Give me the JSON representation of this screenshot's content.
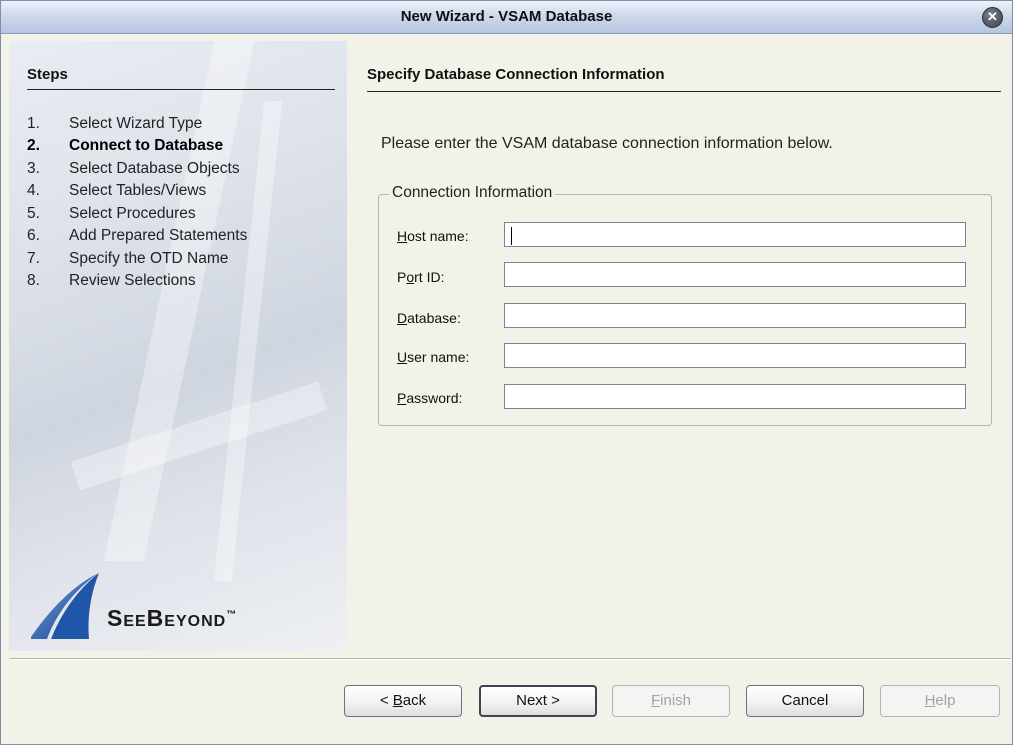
{
  "window": {
    "title": "New Wizard - VSAM Database",
    "close_symbol": "✕"
  },
  "steps": {
    "title": "Steps",
    "items": [
      {
        "num": "1.",
        "label": "Select Wizard Type",
        "current": false
      },
      {
        "num": "2.",
        "label": "Connect to Database",
        "current": true
      },
      {
        "num": "3.",
        "label": "Select Database Objects",
        "current": false
      },
      {
        "num": "4.",
        "label": "Select Tables/Views",
        "current": false
      },
      {
        "num": "5.",
        "label": "Select Procedures",
        "current": false
      },
      {
        "num": "6.",
        "label": "Add Prepared Statements",
        "current": false
      },
      {
        "num": "7.",
        "label": "Specify the OTD Name",
        "current": false
      },
      {
        "num": "8.",
        "label": "Review Selections",
        "current": false
      }
    ]
  },
  "logo": {
    "text": "SeeBeyond",
    "trademark": "™"
  },
  "main": {
    "title": "Specify Database Connection Information",
    "intro": "Please enter the VSAM database connection information below.",
    "group_title": "Connection Information",
    "fields": {
      "host": {
        "label_mnemonic": "H",
        "label_rest": "ost name:",
        "value": ""
      },
      "port": {
        "label_pre": "P",
        "label_mnemonic": "o",
        "label_rest": "rt ID:",
        "value": ""
      },
      "database": {
        "label_mnemonic": "D",
        "label_rest": "atabase:",
        "value": ""
      },
      "user": {
        "label_mnemonic": "U",
        "label_rest": "ser name:",
        "value": ""
      },
      "password": {
        "label_mnemonic": "P",
        "label_rest": "assword:",
        "value": ""
      }
    }
  },
  "buttons": {
    "back": {
      "pre": "< ",
      "mnemonic": "B",
      "rest": "ack"
    },
    "next": {
      "label": "Next >"
    },
    "finish": {
      "mnemonic": "F",
      "rest": "inish"
    },
    "cancel": {
      "label": "Cancel"
    },
    "help": {
      "mnemonic": "H",
      "rest": "elp"
    }
  },
  "colors": {
    "window_bg": "#f3f2e9",
    "title_gradient_bottom": "#b7c5e0",
    "logo_blue": "#1f56a8",
    "disabled_text": "#a3a3a3"
  }
}
